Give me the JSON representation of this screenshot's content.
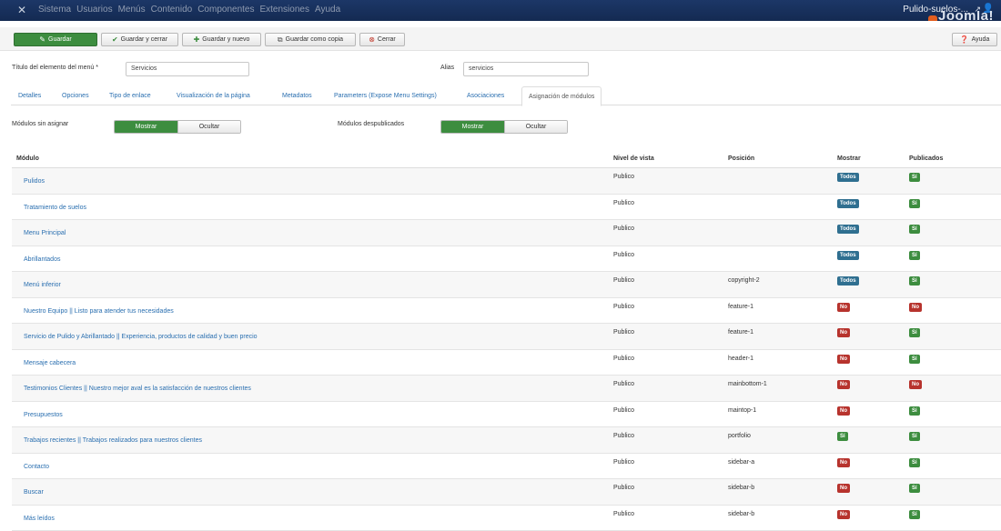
{
  "topbar": {
    "logo_icon": "joomla-logo-icon",
    "menu": [
      "Sistema",
      "Usuarios",
      "Menús",
      "Contenido",
      "Componentes",
      "Extensiones",
      "Ayuda"
    ],
    "site_name": "Pulido-suelos-...",
    "site_icon": "external-link-icon",
    "user_icon": "user-icon",
    "brand": "Joomla!"
  },
  "toolbar": {
    "save": "Guardar",
    "save_close": "Guardar y cerrar",
    "save_new": "Guardar y nuevo",
    "save_copy": "Guardar como copia",
    "close": "Cerrar",
    "help": "Ayuda"
  },
  "form": {
    "title_label": "Título del elemento del menú *",
    "title_value": "Servicios",
    "alias_label": "Alias",
    "alias_value": "servicios"
  },
  "tabs": [
    "Detalles",
    "Opciones",
    "Tipo de enlace",
    "Visualización de la página",
    "Metadatos",
    "Parameters (Expose Menu Settings)",
    "Asociaciones",
    "Asignación de módulos"
  ],
  "toggles": {
    "unassigned_label": "Módulos sin asignar",
    "unpublished_label": "Módulos despublicados",
    "show": "Mostrar",
    "hide": "Ocultar"
  },
  "table": {
    "headers": {
      "module": "Módulo",
      "view_level": "Nivel de vista",
      "position": "Posición",
      "show": "Mostrar",
      "published": "Publicados"
    },
    "rows": [
      {
        "module": "Pulidos",
        "level": "Publico",
        "position": "",
        "show": "Todos",
        "published": "Sí"
      },
      {
        "module": "Tratamiento de suelos",
        "level": "Publico",
        "position": "",
        "show": "Todos",
        "published": "Sí"
      },
      {
        "module": "Menu Principal",
        "level": "Publico",
        "position": "",
        "show": "Todos",
        "published": "Sí"
      },
      {
        "module": "Abrillantados",
        "level": "Publico",
        "position": "",
        "show": "Todos",
        "published": "Sí"
      },
      {
        "module": "Menú inferior",
        "level": "Publico",
        "position": "copyright-2",
        "show": "Todos",
        "published": "Sí"
      },
      {
        "module": "Nuestro Equipo || Listo para atender tus necesidades",
        "level": "Publico",
        "position": "feature-1",
        "show": "No",
        "published": "No"
      },
      {
        "module": "Servicio de Pulido y Abrillantado || Experiencia, productos de calidad y buen precio",
        "level": "Publico",
        "position": "feature-1",
        "show": "No",
        "published": "Sí"
      },
      {
        "module": "Mensaje cabecera",
        "level": "Publico",
        "position": "header-1",
        "show": "No",
        "published": "Sí"
      },
      {
        "module": "Testimonios Clientes || Nuestro mejor aval es la satisfacción de nuestros clientes",
        "level": "Publico",
        "position": "mainbottom-1",
        "show": "No",
        "published": "No"
      },
      {
        "module": "Presupuestos",
        "level": "Publico",
        "position": "maintop-1",
        "show": "No",
        "published": "Sí"
      },
      {
        "module": "Trabajos recientes || Trabajos realizados para nuestros clientes",
        "level": "Publico",
        "position": "portfolio",
        "show": "Sí",
        "published": "Sí"
      },
      {
        "module": "Contacto",
        "level": "Publico",
        "position": "sidebar-a",
        "show": "No",
        "published": "Sí"
      },
      {
        "module": "Buscar",
        "level": "Publico",
        "position": "sidebar-b",
        "show": "No",
        "published": "Sí"
      },
      {
        "module": "Más leídos",
        "level": "Publico",
        "position": "sidebar-b",
        "show": "No",
        "published": "Sí"
      }
    ]
  },
  "colors": {
    "navbar": "#1c3767",
    "success": "#3d8d3f",
    "danger": "#b7332d",
    "info": "#2f6f90",
    "link": "#2a6fb0"
  }
}
